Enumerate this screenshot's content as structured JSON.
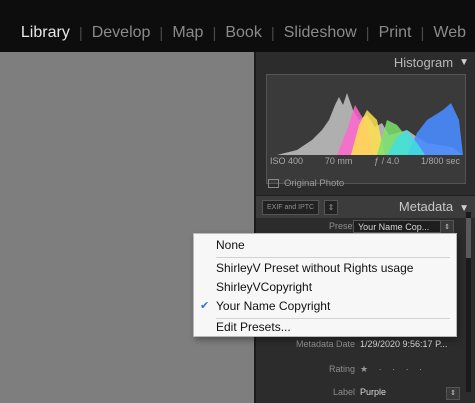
{
  "modules": [
    "Library",
    "Develop",
    "Map",
    "Book",
    "Slideshow",
    "Print",
    "Web"
  ],
  "active_module": "Library",
  "histogram": {
    "title": "Histogram",
    "iso": "ISO 400",
    "focal": "70 mm",
    "aperture": "ƒ / 4.0",
    "shutter": "1/800 sec",
    "original_photo": "Original Photo"
  },
  "metadata": {
    "title": "Metadata",
    "exif_select": "EXIF and IPTC",
    "exif_arrow": "⇕",
    "preset_label": "Preset",
    "preset_value": "Your Name Cop...",
    "preset_arrow": "⇕",
    "date_label": "Metadata Date",
    "date_value": "1/29/2020 9:56:17 P...",
    "rating_label": "Rating",
    "rating_stars": "★ · · · ·",
    "label_label": "Label",
    "label_value": "Purple",
    "label_arrow": "⇕"
  },
  "menu": {
    "items": [
      "None",
      "ShirleyV Preset without Rights usage",
      "ShirleyVCopyright",
      "Your Name Copyright",
      "Edit Presets..."
    ],
    "checked": "Your Name Copyright",
    "check_glyph": "✔"
  },
  "icons": {
    "collapse": "▼"
  },
  "colors": {
    "topbar": "#0d0d0d",
    "panel": "#2c2c2c",
    "viewer": "#7e7e7e",
    "menu_bg": "#f7f7f7",
    "check": "#3b6fd6"
  }
}
